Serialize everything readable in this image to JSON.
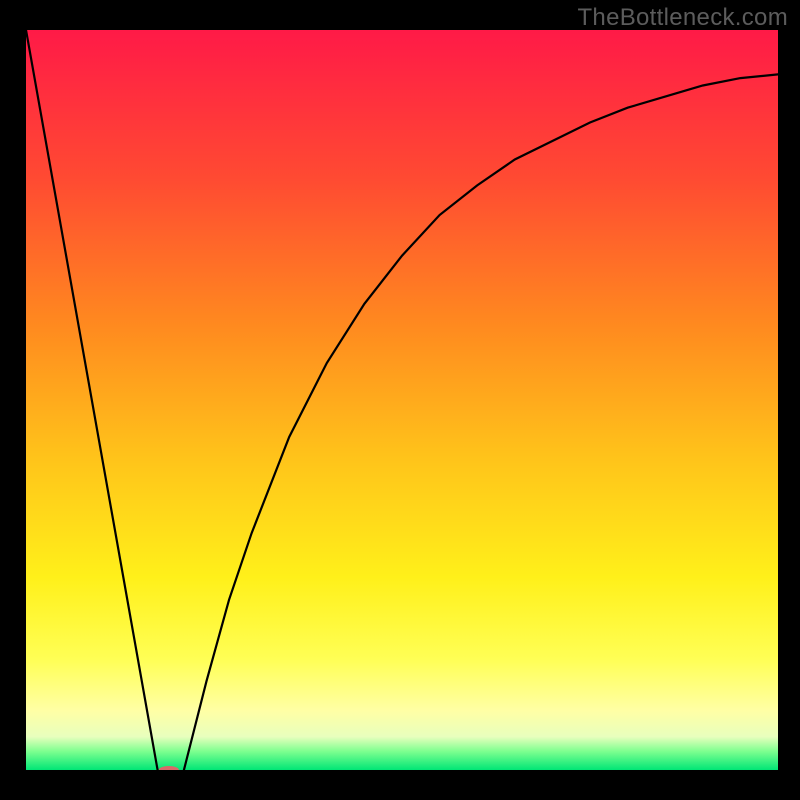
{
  "watermark": "TheBottleneck.com",
  "chart_data": {
    "type": "line",
    "title": "",
    "xlabel": "",
    "ylabel": "",
    "x_range": [
      0,
      100
    ],
    "y_range": [
      0,
      100
    ],
    "gradient_stops": [
      {
        "offset": 0.0,
        "color": "#ff1a47"
      },
      {
        "offset": 0.2,
        "color": "#ff4a32"
      },
      {
        "offset": 0.4,
        "color": "#ff8a1f"
      },
      {
        "offset": 0.58,
        "color": "#ffc41a"
      },
      {
        "offset": 0.74,
        "color": "#fff01a"
      },
      {
        "offset": 0.85,
        "color": "#ffff55"
      },
      {
        "offset": 0.92,
        "color": "#ffffa5"
      },
      {
        "offset": 0.955,
        "color": "#e8ffbd"
      },
      {
        "offset": 0.975,
        "color": "#7cff8f"
      },
      {
        "offset": 1.0,
        "color": "#00e676"
      }
    ],
    "series": [
      {
        "name": "descending-branch",
        "x": [
          0,
          17.5
        ],
        "y": [
          100,
          0
        ]
      },
      {
        "name": "ascending-curve",
        "x": [
          21,
          24,
          27,
          30,
          35,
          40,
          45,
          50,
          55,
          60,
          65,
          70,
          75,
          80,
          85,
          90,
          95,
          100
        ],
        "y": [
          0,
          12,
          23,
          32,
          45,
          55,
          63,
          69.5,
          75,
          79,
          82.5,
          85,
          87.5,
          89.5,
          91,
          92.5,
          93.5,
          94
        ]
      }
    ],
    "marker": {
      "name": "highlight-marker",
      "x": 19,
      "y": 0,
      "color": "#d86a6a",
      "rx": 10,
      "ry": 4
    }
  }
}
